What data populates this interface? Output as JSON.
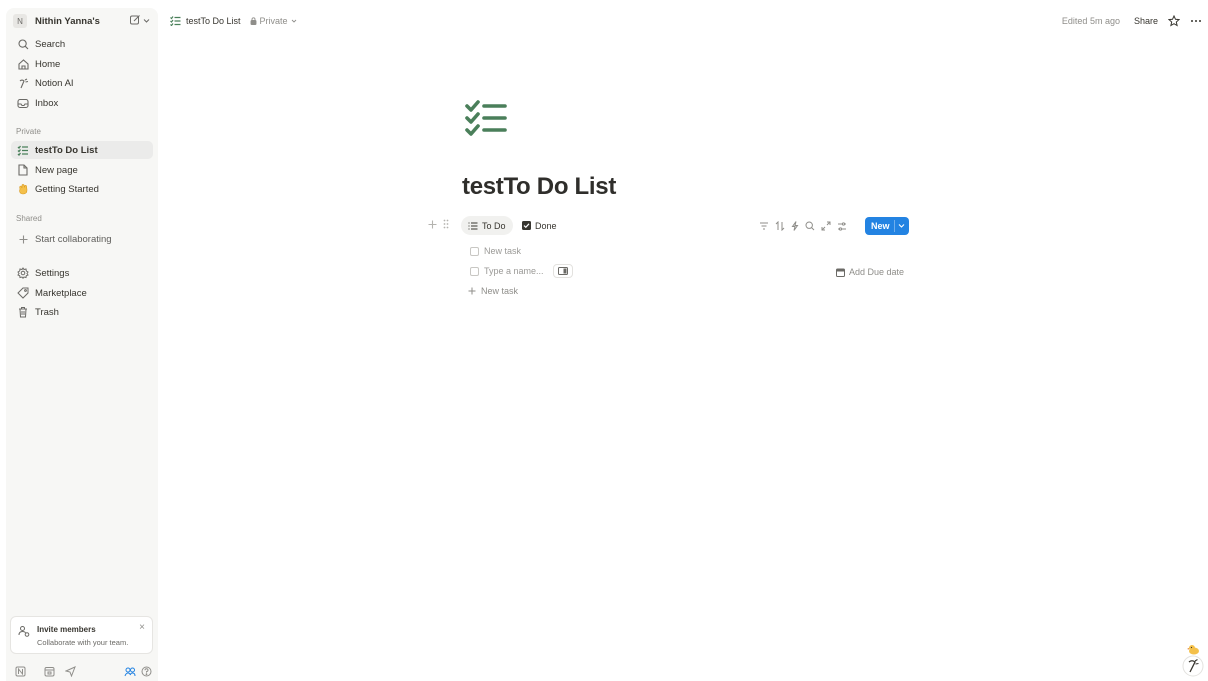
{
  "sidebar": {
    "workspace_initial": "N",
    "workspace_name": "Nithin Yanna's",
    "nav": {
      "search": "Search",
      "home": "Home",
      "notion_ai": "Notion AI",
      "inbox": "Inbox"
    },
    "private_label": "Private",
    "private_pages": {
      "todo": "testTo Do List",
      "new_page": "New page",
      "getting_started": "Getting Started"
    },
    "shared_label": "Shared",
    "start_collaborating": "Start collaborating",
    "settings": "Settings",
    "marketplace": "Marketplace",
    "trash": "Trash",
    "invite": {
      "title": "Invite members",
      "subtitle": "Collaborate with your team."
    }
  },
  "topbar": {
    "page_title": "testTo Do List",
    "privacy": "Private",
    "edited": "Edited 5m ago",
    "share": "Share"
  },
  "page": {
    "title": "testTo Do List",
    "icon": "checklist-icon",
    "accent_color": "#4a7f5a"
  },
  "database": {
    "views": {
      "todo": "To Do",
      "done": "Done"
    },
    "new_button": "New",
    "tasks": {
      "first_placeholder": "New task",
      "second_placeholder": "Type a name..."
    },
    "due_date_label": "Add Due date",
    "add_row_label": "New task"
  },
  "colors": {
    "primary_button": "#2383e2",
    "sidebar_bg": "#f7f7f5"
  }
}
